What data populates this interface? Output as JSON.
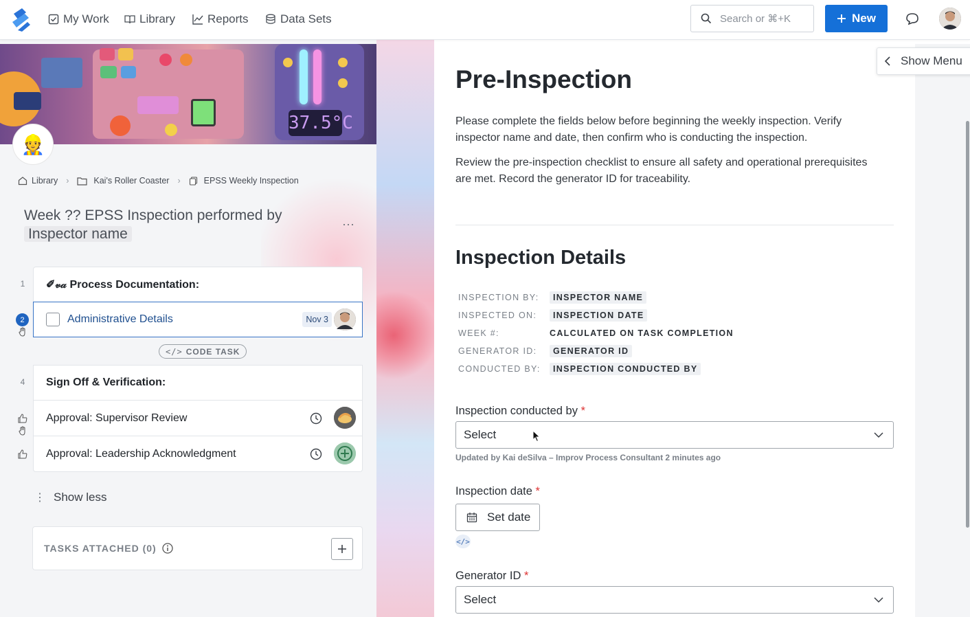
{
  "nav": {
    "items": [
      {
        "label": "My Work",
        "icon": "checkbox-icon"
      },
      {
        "label": "Library",
        "icon": "book-icon"
      },
      {
        "label": "Reports",
        "icon": "chart-icon"
      },
      {
        "label": "Data Sets",
        "icon": "database-icon"
      }
    ],
    "search_placeholder": "Search or ⌘+K",
    "new_label": "New"
  },
  "banner": {
    "display_text": "37.5°C"
  },
  "breadcrumb": [
    "Library",
    "Kai's Roller Coaster",
    "EPSS Weekly Inspection"
  ],
  "task": {
    "title_prefix": "Week ?? EPSS Inspection performed by",
    "title_chip": "Inspector name",
    "more": "···"
  },
  "steps": {
    "header1_num": "1",
    "header1_label": "✐𝓋𝒶 Process Documentation:",
    "item2_badge": "2",
    "item2_label": "Administrative Details",
    "item2_due": "Nov 3",
    "code_task": "CODE TASK",
    "header4_num": "4",
    "header4_label": "Sign Off & Verification:",
    "item5_label": "Approval: Supervisor Review",
    "item6_label": "Approval: Leadership Acknowledgment",
    "show_less": "Show less",
    "attached_label": "TASKS ATTACHED (0)"
  },
  "content": {
    "show_menu": "Show Menu",
    "title": "Pre-Inspection",
    "intro1": "Please complete the fields below before beginning the weekly inspection. Verify inspector name and date, then confirm who is conducting the inspection.",
    "intro2": "Review the pre-inspection checklist to ensure all safety and operational prerequisites are met. Record the generator ID for traceability.",
    "details_title": "Inspection Details",
    "meta": [
      {
        "key": "INSPECTION BY:",
        "value": "INSPECTOR NAME"
      },
      {
        "key": "INSPECTED ON:",
        "value": "INSPECTION DATE"
      },
      {
        "key": "WEEK #:",
        "value": "CALCULATED ON TASK COMPLETION"
      },
      {
        "key": "GENERATOR ID:",
        "value": "GENERATOR ID"
      },
      {
        "key": "CONDUCTED BY:",
        "value": "INSPECTION CONDUCTED BY"
      }
    ],
    "field1_label": "Inspection conducted by",
    "field1_value": "Select",
    "field1_updated": "Updated by Kai deSilva – Improv Process Consultant 2 minutes ago",
    "field2_label": "Inspection date",
    "field2_button": "Set date",
    "code_chip": "</>",
    "field3_label": "Generator ID",
    "field3_value": "Select",
    "required_mark": "*"
  },
  "colors": {
    "primary": "#1570d8",
    "active_border": "#3773c5",
    "required": "#dd3333"
  }
}
